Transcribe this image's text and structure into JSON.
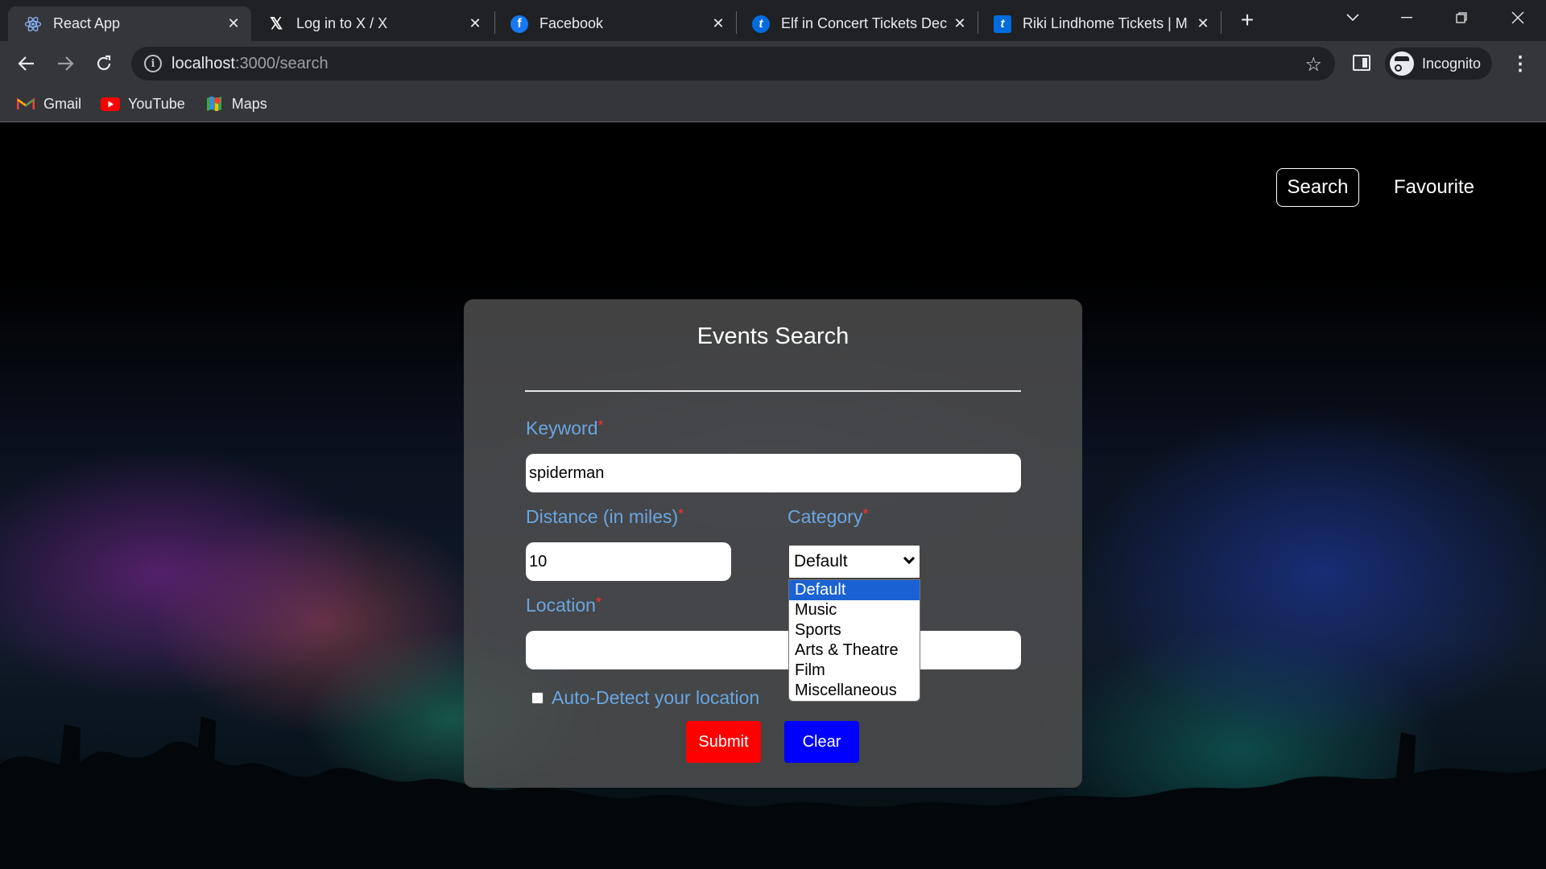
{
  "browser": {
    "tabs": [
      {
        "title": "React App",
        "icon": "react-icon"
      },
      {
        "title": "Log in to X / X",
        "icon": "x-logo-icon"
      },
      {
        "title": "Facebook",
        "icon": "facebook-icon"
      },
      {
        "title": "Elf in Concert Tickets Dec",
        "icon": "ticketmaster-icon"
      },
      {
        "title": "Riki Lindhome Tickets | M",
        "icon": "ticketmaster-icon"
      }
    ],
    "url_host": "localhost",
    "url_path": ":3000/search",
    "profile_label": "Incognito",
    "bookmarks": [
      {
        "label": "Gmail",
        "icon": "gmail-icon"
      },
      {
        "label": "YouTube",
        "icon": "youtube-icon"
      },
      {
        "label": "Maps",
        "icon": "maps-icon"
      }
    ]
  },
  "nav": {
    "search": "Search",
    "favourite": "Favourite"
  },
  "form": {
    "title": "Events Search",
    "keyword_label": "Keyword",
    "keyword_value": "spiderman",
    "distance_label": "Distance (in miles)",
    "distance_value": "10",
    "category_label": "Category",
    "category_value": "Default",
    "category_options": [
      "Default",
      "Music",
      "Sports",
      "Arts & Theatre",
      "Film",
      "Miscellaneous"
    ],
    "location_label": "Location",
    "location_value": "",
    "required_mark": "*",
    "autodetect_label": "Auto-Detect your location",
    "submit": "Submit",
    "clear": "Clear"
  },
  "colors": {
    "label": "#6aa6e0",
    "submit": "#ff0000",
    "clear": "#0000ff",
    "selected_option": "#1a62d4"
  }
}
